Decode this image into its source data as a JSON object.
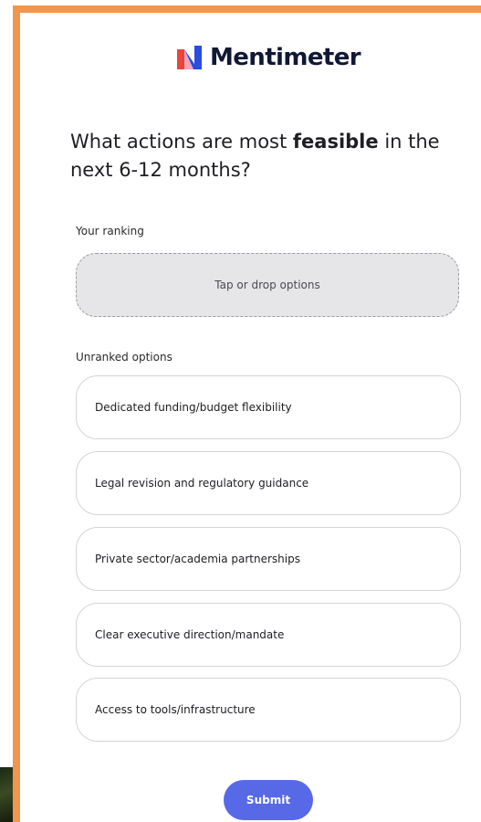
{
  "brand": {
    "name": "Mentimeter",
    "colors": {
      "accent_orange": "#f0964f",
      "logo_red": "#e8453c",
      "logo_blue": "#2a4ce0",
      "logo_pink": "#f4a6b7",
      "submit_blue": "#5769e7"
    }
  },
  "question": {
    "prefix": "What actions are most ",
    "emphasis": "feasible",
    "suffix": " in the next 6-12 months?"
  },
  "ranking": {
    "label": "Your ranking",
    "drop_hint": "Tap or drop options"
  },
  "unranked": {
    "label": "Unranked options",
    "options": [
      "Dedicated funding/budget flexibility",
      "Legal revision and regulatory guidance",
      "Private sector/academia partnerships",
      "Clear executive direction/mandate",
      "Access to tools/infrastructure"
    ]
  },
  "submit": {
    "label": "Submit"
  }
}
